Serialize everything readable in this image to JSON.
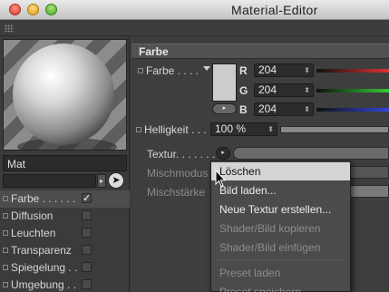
{
  "window": {
    "title": "Material-Editor"
  },
  "material": {
    "name": "Mat"
  },
  "channels": [
    {
      "label": "Farbe . . . . . .",
      "checked": true
    },
    {
      "label": "Diffusion",
      "checked": false
    },
    {
      "label": "Leuchten",
      "checked": false
    },
    {
      "label": "Transparenz",
      "checked": false
    },
    {
      "label": "Spiegelung . .",
      "checked": false
    },
    {
      "label": "Umgebung . .",
      "checked": false
    }
  ],
  "section": {
    "title": "Farbe"
  },
  "color": {
    "label": "Farbe . . . .",
    "swatch_color": "#cccccc",
    "r_label": "R",
    "r_value": "204",
    "g_label": "G",
    "g_value": "204",
    "b_label": "B",
    "b_value": "204"
  },
  "brightness": {
    "label": "Helligkeit . . .",
    "value": "100 %",
    "level_percent": 100
  },
  "texture": {
    "label": "Textur. . . . . . ."
  },
  "mix_mode": {
    "label": "Mischmodus"
  },
  "mix_strength": {
    "label": "Mischstärke"
  },
  "menu": {
    "items": [
      {
        "label": "Löschen",
        "highlighted": true,
        "enabled": true
      },
      {
        "label": "Bild laden...",
        "enabled": true
      },
      {
        "label": "Neue Textur erstellen...",
        "enabled": true
      },
      {
        "label": "Shader/Bild kopieren",
        "enabled": false
      },
      {
        "label": "Shader/Bild einfügen",
        "enabled": false
      },
      {
        "label": "Preset laden",
        "enabled": false
      },
      {
        "label": "Preset speichern",
        "enabled": false
      }
    ]
  },
  "icons": [
    "close-icon",
    "minimize-icon",
    "zoom-icon",
    "grip-icon",
    "dropdown-arrow-icon",
    "play-arrow-icon",
    "pointer-icon",
    "checkmark-icon"
  ]
}
